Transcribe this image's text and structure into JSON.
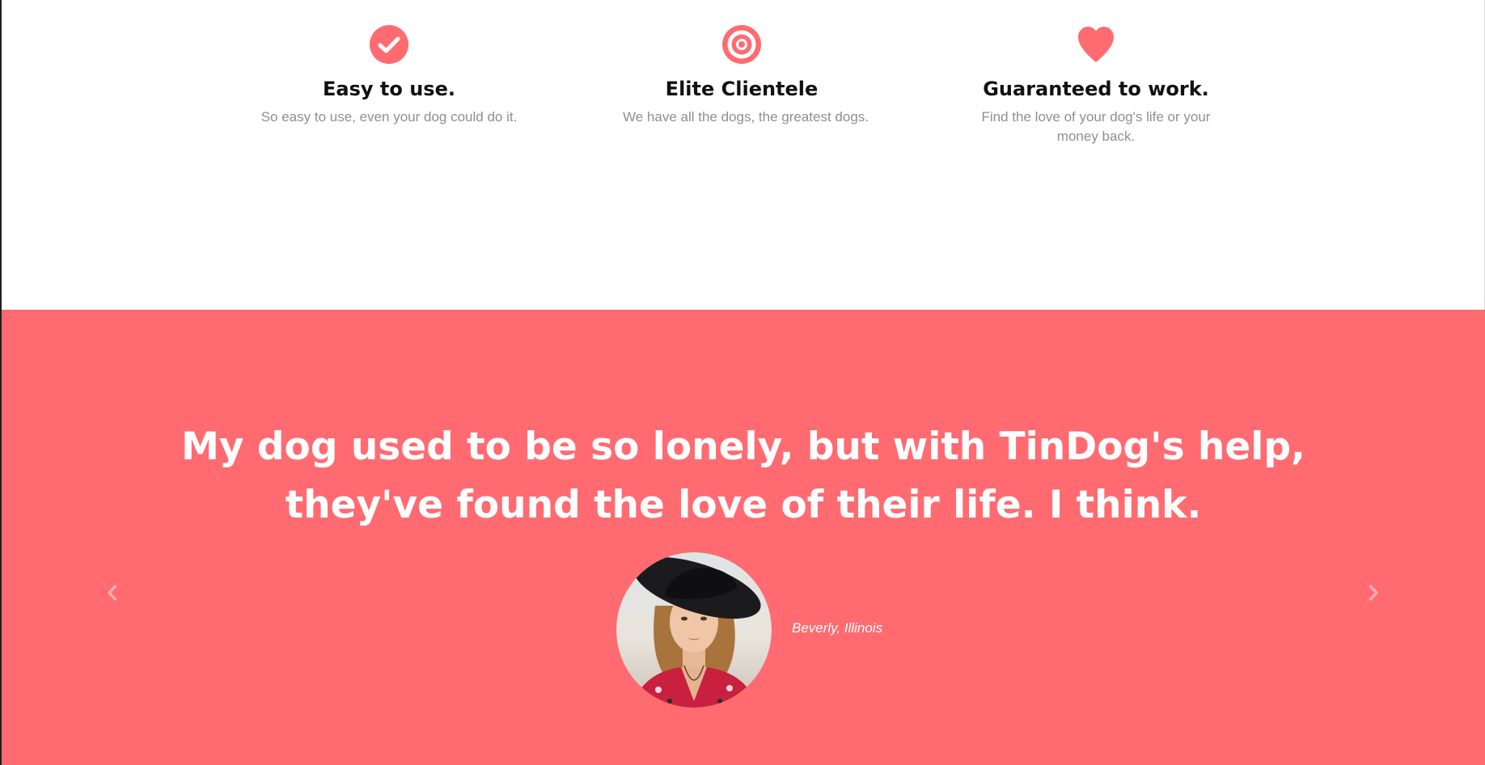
{
  "colors": {
    "accent": "#ff6b71",
    "heading": "#111111",
    "muted_text": "#8f8f8f",
    "background": "#ffffff"
  },
  "features": [
    {
      "icon": "check-circle-icon",
      "title": "Easy to use.",
      "text": "So easy to use, even your dog could do it."
    },
    {
      "icon": "bullseye-icon",
      "title": "Elite Clientele",
      "text": "We have all the dogs, the greatest dogs."
    },
    {
      "icon": "heart-icon",
      "title": "Guaranteed to work.",
      "text": "Find the love of your dog's life or your money back."
    }
  ],
  "testimonial": {
    "quote": "My dog used to be so lonely, but with TinDog's help, they've found the love of their life. I think.",
    "caption": "Beverly, Illinois",
    "avatar": "woman-in-black-hat-portrait"
  },
  "carousel": {
    "prev_icon": "chevron-left-icon",
    "next_icon": "chevron-right-icon"
  }
}
